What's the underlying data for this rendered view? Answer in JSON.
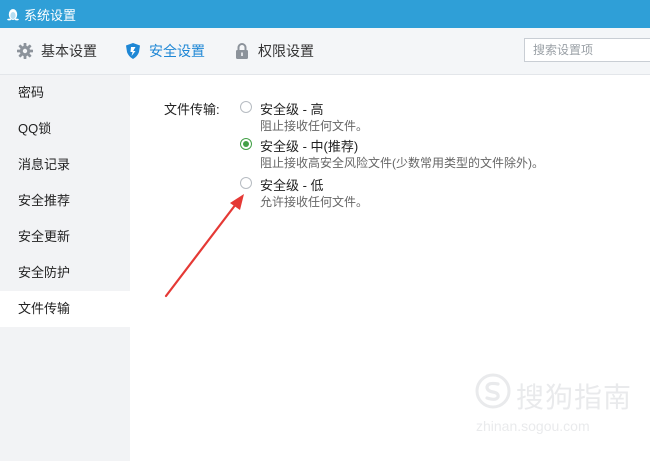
{
  "window": {
    "title": "系统设置"
  },
  "tabs": [
    {
      "label": "基本设置",
      "icon": "gear-icon",
      "active": false
    },
    {
      "label": "安全设置",
      "icon": "shield-icon",
      "active": true
    },
    {
      "label": "权限设置",
      "icon": "lock-icon",
      "active": false
    }
  ],
  "search": {
    "placeholder": "搜索设置项",
    "value": ""
  },
  "sidebar": {
    "items": [
      {
        "label": "密码"
      },
      {
        "label": "QQ锁"
      },
      {
        "label": "消息记录"
      },
      {
        "label": "安全推荐"
      },
      {
        "label": "安全更新"
      },
      {
        "label": "安全防护"
      },
      {
        "label": "文件传输",
        "active": true
      }
    ]
  },
  "file_transfer": {
    "label": "文件传输:",
    "options": [
      {
        "title": "安全级 - 高",
        "desc": "阻止接收任何文件。",
        "checked": false
      },
      {
        "title": "安全级 - 中(推荐)",
        "desc": "阻止接收高安全风险文件(少数常用类型的文件除外)。",
        "checked": true
      },
      {
        "title": "安全级 - 低",
        "desc": "允许接收任何文件。",
        "checked": false
      }
    ]
  },
  "watermark": {
    "text": "搜狗指南",
    "url": "zhinan.sogou.com"
  },
  "colors": {
    "titlebar": "#2f9fd7",
    "accent": "#1e87d5",
    "radio_checked": "#43a047",
    "arrow": "#e53935"
  }
}
